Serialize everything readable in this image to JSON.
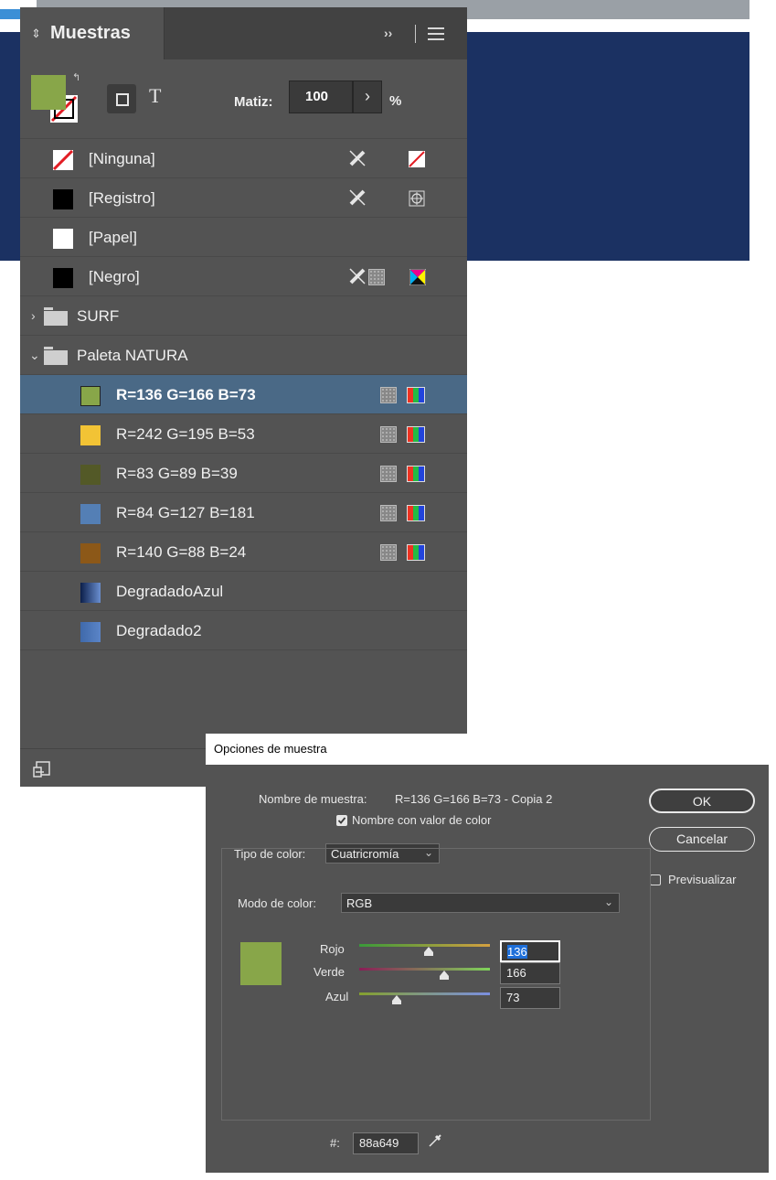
{
  "panel": {
    "title": "Muestras",
    "tint_label": "Matiz:",
    "tint_value": "100",
    "tint_unit": "%",
    "stepper_glyph": "›",
    "text_icon": "T",
    "swatches": [
      {
        "label": "[Ninguna]",
        "color": "none"
      },
      {
        "label": "[Registro]",
        "color": "#000000"
      },
      {
        "label": "[Papel]",
        "color": "#ffffff"
      },
      {
        "label": "[Negro]",
        "color": "#000000"
      }
    ],
    "groups": [
      {
        "label": "SURF",
        "expanded": false
      },
      {
        "label": "Paleta NATURA",
        "expanded": true
      }
    ],
    "group_items": [
      {
        "label": "R=136 G=166 B=73",
        "color": "#88a649",
        "selected": true
      },
      {
        "label": "R=242 G=195 B=53",
        "color": "#f2c335",
        "selected": false
      },
      {
        "label": "R=83 G=89 B=39",
        "color": "#535927",
        "selected": false
      },
      {
        "label": "R=84 G=127 B=181",
        "color": "#547fb5",
        "selected": false
      },
      {
        "label": "R=140 G=88 B=24",
        "color": "#8c5818",
        "selected": false
      },
      {
        "label": "DegradadoAzul",
        "color": "gradient-dark-blue",
        "selected": false
      },
      {
        "label": "Degradado2",
        "color": "gradient-blue",
        "selected": false
      }
    ]
  },
  "dialog": {
    "title": "Opciones de muestra",
    "name_label": "Nombre de muestra:",
    "name_value": "R=136 G=166 B=73 - Copia 2",
    "name_with_value_label": "Nombre con valor de color",
    "name_with_value_checked": true,
    "color_type_label": "Tipo de color:",
    "color_type_value": "Cuatricromía",
    "color_mode_label": "Modo de color:",
    "color_mode_value": "RGB",
    "ok_label": "OK",
    "cancel_label": "Cancelar",
    "preview_label": "Previsualizar",
    "preview_checked": false,
    "preview_color": "#88a649",
    "channels": [
      {
        "label": "Rojo",
        "value": "136",
        "fraction": 0.533
      },
      {
        "label": "Verde",
        "value": "166",
        "fraction": 0.651
      },
      {
        "label": "Azul",
        "value": "73",
        "fraction": 0.286
      }
    ],
    "hex_label": "#:",
    "hex_value": "88a649"
  }
}
